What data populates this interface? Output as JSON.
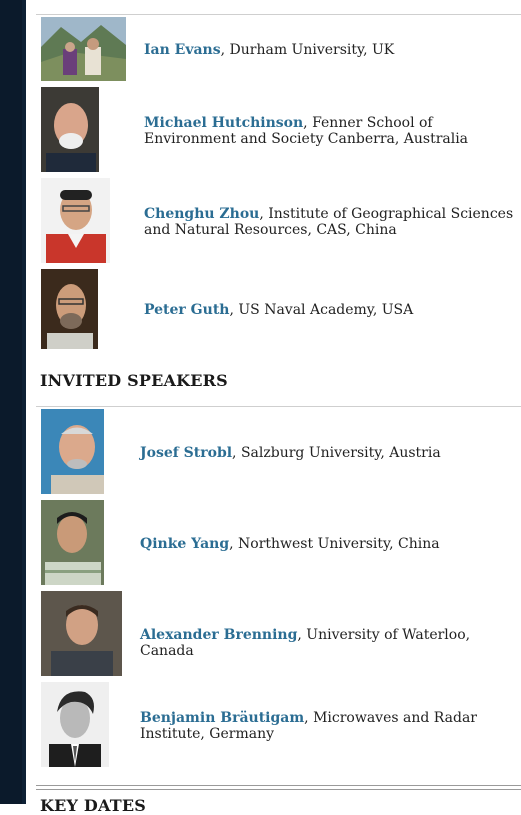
{
  "organisers": [
    {
      "name": "Ian Evans",
      "affiliation": ", Durham University, UK"
    },
    {
      "name": "Michael Hutchinson",
      "affiliation": ", Fenner School of Environment and Society Canberra, Australia"
    },
    {
      "name": "Chenghu Zhou",
      "affiliation": ", Institute of Geographical Sciences and Natural Resources, CAS, China"
    },
    {
      "name": "Peter Guth",
      "affiliation": ", US Naval Academy, USA"
    }
  ],
  "invited": {
    "heading": "INVITED SPEAKERS",
    "speakers": [
      {
        "name": "Josef Strobl",
        "affiliation": ", Salzburg University, Austria"
      },
      {
        "name": "Qinke Yang",
        "affiliation": ", Northwest University, China"
      },
      {
        "name": "Alexander Brenning",
        "affiliation": ", University of Waterloo, Canada"
      },
      {
        "name": "Benjamin Bräutigam",
        "affiliation": ", Microwaves and Radar Institute, Germany"
      }
    ]
  },
  "next_section": {
    "heading": "KEY DATES"
  }
}
